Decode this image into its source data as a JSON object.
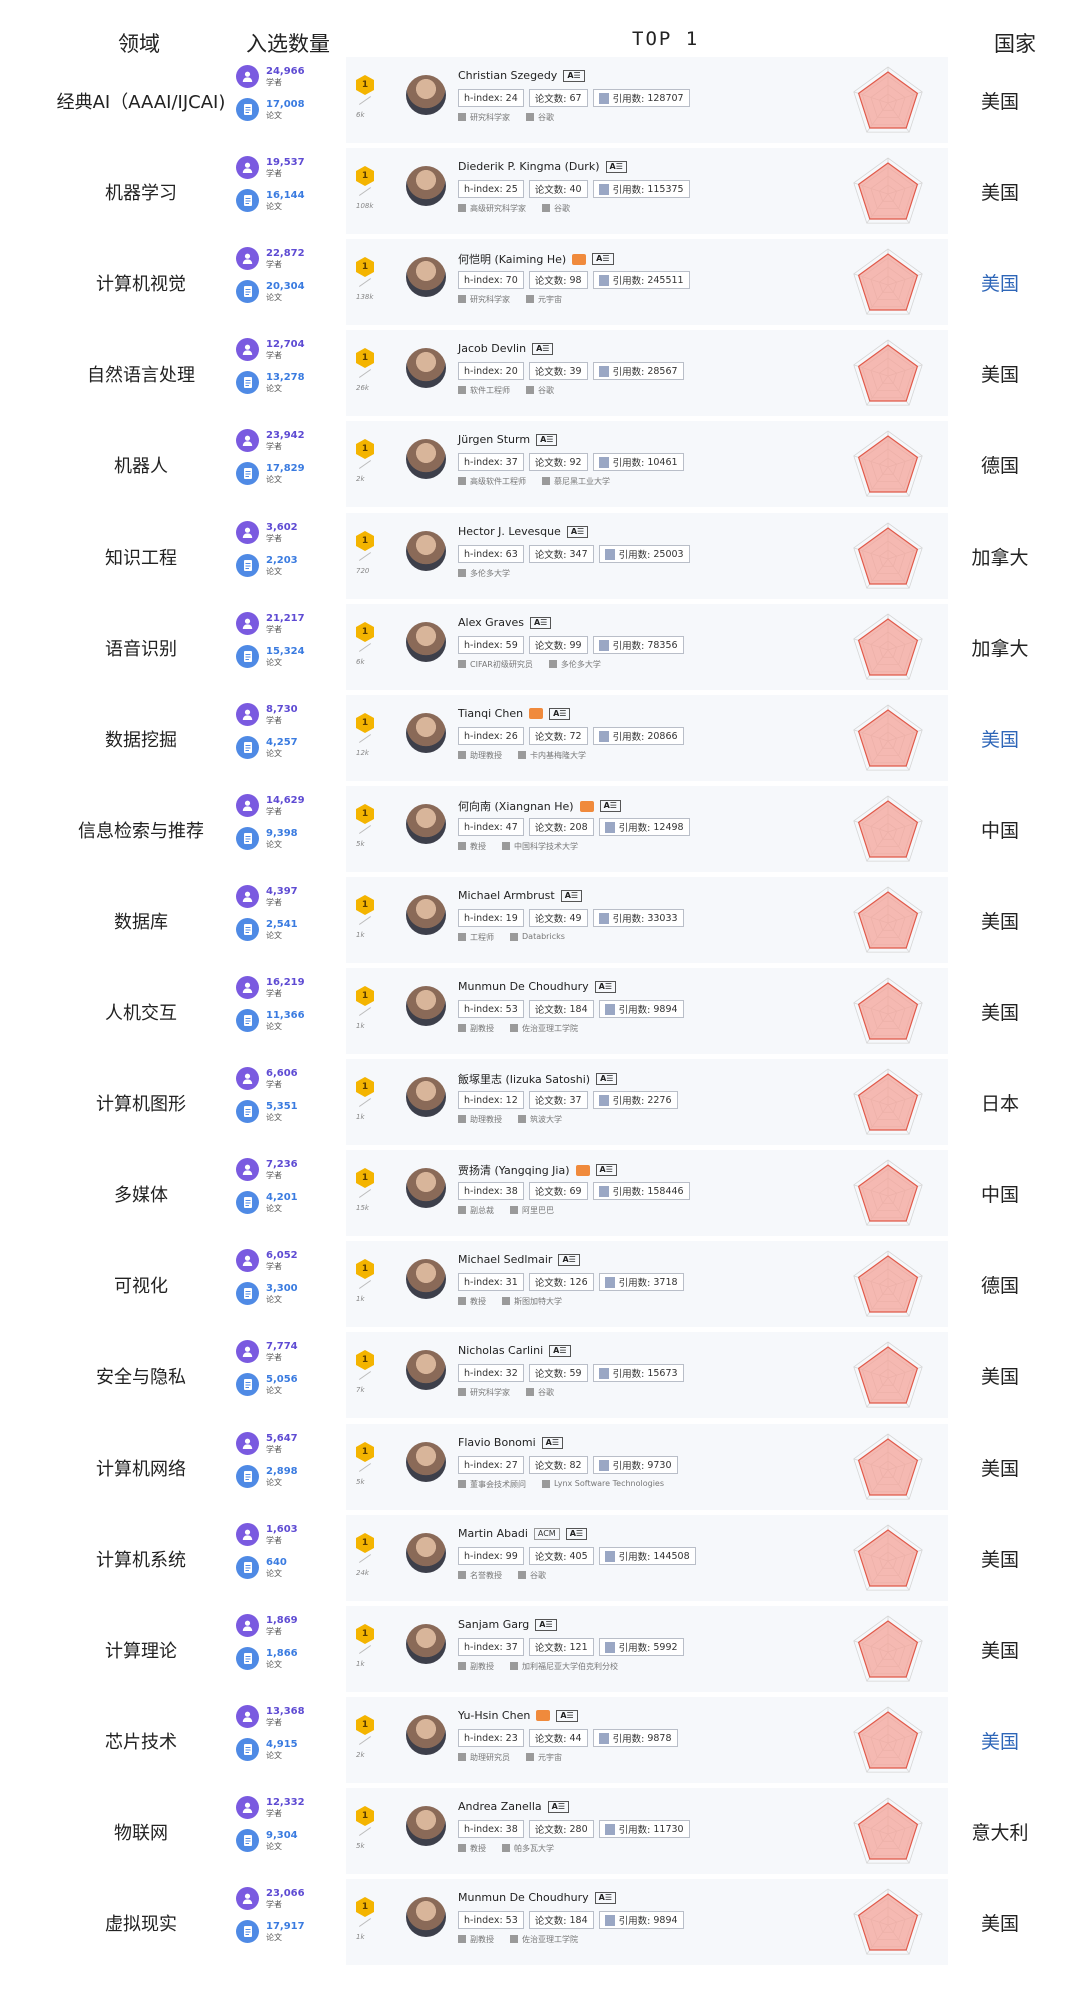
{
  "header": {
    "domain": "领域",
    "count": "入选数量",
    "top": "TOP 1",
    "country": "国家"
  },
  "labels": {
    "scholar": "学者",
    "paper": "论文",
    "hindex": "h-index:",
    "papers": "论文数:",
    "citations": "引用数:",
    "ai_badge": "A☰",
    "acm_badge": "ACM"
  },
  "colors": {
    "scholar_icon": "#7a5ae0",
    "paper_icon": "#4f8ae5",
    "medal": "#f4b400",
    "radar_fill": "#f4a49a",
    "radar_stroke": "#e05a4a",
    "country_blue": "#2e66b8"
  },
  "rows": [
    {
      "domain": "经典AI（AAAI/IJCAI)",
      "scholars": "24,966",
      "papers": "17,008",
      "medal_note": "6k",
      "name": "Christian Szegedy",
      "orange": false,
      "acm": false,
      "hindex": "24",
      "papercount": "67",
      "cites": "128707",
      "title": "研究科学家",
      "org": "谷歌",
      "country": "美国",
      "country_blue": false
    },
    {
      "domain": "机器学习",
      "scholars": "19,537",
      "papers": "16,144",
      "medal_note": "108k",
      "name": "Diederik P. Kingma (Durk)",
      "orange": false,
      "acm": false,
      "hindex": "25",
      "papercount": "40",
      "cites": "115375",
      "title": "高级研究科学家",
      "org": "谷歌",
      "country": "美国",
      "country_blue": false
    },
    {
      "domain": "计算机视觉",
      "scholars": "22,872",
      "papers": "20,304",
      "medal_note": "138k",
      "name": "何恺明 (Kaiming He)",
      "orange": true,
      "acm": false,
      "hindex": "70",
      "papercount": "98",
      "cites": "245511",
      "title": "研究科学家",
      "org": "元宇宙",
      "country": "美国",
      "country_blue": true
    },
    {
      "domain": "自然语言处理",
      "scholars": "12,704",
      "papers": "13,278",
      "medal_note": "26k",
      "name": "Jacob Devlin",
      "orange": false,
      "acm": false,
      "hindex": "20",
      "papercount": "39",
      "cites": "28567",
      "title": "软件工程师",
      "org": "谷歌",
      "country": "美国",
      "country_blue": false
    },
    {
      "domain": "机器人",
      "scholars": "23,942",
      "papers": "17,829",
      "medal_note": "2k",
      "name": "Jürgen Sturm",
      "orange": false,
      "acm": false,
      "hindex": "37",
      "papercount": "92",
      "cites": "10461",
      "title": "高级软件工程师",
      "org": "慕尼黑工业大学",
      "country": "德国",
      "country_blue": false
    },
    {
      "domain": "知识工程",
      "scholars": "3,602",
      "papers": "2,203",
      "medal_note": "720",
      "name": "Hector J. Levesque",
      "orange": false,
      "acm": false,
      "hindex": "63",
      "papercount": "347",
      "cites": "25003",
      "title": "多伦多大学",
      "org": "",
      "country": "加拿大",
      "country_blue": false
    },
    {
      "domain": "语音识别",
      "scholars": "21,217",
      "papers": "15,324",
      "medal_note": "6k",
      "name": "Alex Graves",
      "orange": false,
      "acm": false,
      "hindex": "59",
      "papercount": "99",
      "cites": "78356",
      "title": "CIFAR初级研究员",
      "org": "多伦多大学",
      "country": "加拿大",
      "country_blue": false
    },
    {
      "domain": "数据挖掘",
      "scholars": "8,730",
      "papers": "4,257",
      "medal_note": "12k",
      "name": "Tianqi Chen",
      "orange": true,
      "acm": false,
      "hindex": "26",
      "papercount": "72",
      "cites": "20866",
      "title": "助理教授",
      "org": "卡内基梅隆大学",
      "country": "美国",
      "country_blue": true
    },
    {
      "domain": "信息检索与推荐",
      "scholars": "14,629",
      "papers": "9,398",
      "medal_note": "5k",
      "name": "何向南 (Xiangnan He)",
      "orange": true,
      "acm": false,
      "hindex": "47",
      "papercount": "208",
      "cites": "12498",
      "title": "教授",
      "org": "中国科学技术大学",
      "country": "中国",
      "country_blue": false
    },
    {
      "domain": "数据库",
      "scholars": "4,397",
      "papers": "2,541",
      "medal_note": "1k",
      "name": "Michael Armbrust",
      "orange": false,
      "acm": false,
      "hindex": "19",
      "papercount": "49",
      "cites": "33033",
      "title": "工程师",
      "org": "Databricks",
      "country": "美国",
      "country_blue": false
    },
    {
      "domain": "人机交互",
      "scholars": "16,219",
      "papers": "11,366",
      "medal_note": "1k",
      "name": "Munmun De Choudhury",
      "orange": false,
      "acm": false,
      "hindex": "53",
      "papercount": "184",
      "cites": "9894",
      "title": "副教授",
      "org": "佐治亚理工学院",
      "country": "美国",
      "country_blue": false
    },
    {
      "domain": "计算机图形",
      "scholars": "6,606",
      "papers": "5,351",
      "medal_note": "1k",
      "name": "飯塚里志 (Iizuka Satoshi)",
      "orange": false,
      "acm": false,
      "hindex": "12",
      "papercount": "37",
      "cites": "2276",
      "title": "助理教授",
      "org": "筑波大学",
      "country": "日本",
      "country_blue": false
    },
    {
      "domain": "多媒体",
      "scholars": "7,236",
      "papers": "4,201",
      "medal_note": "15k",
      "name": "贾扬清 (Yangqing Jia)",
      "orange": true,
      "acm": false,
      "hindex": "38",
      "papercount": "69",
      "cites": "158446",
      "title": "副总裁",
      "org": "阿里巴巴",
      "country": "中国",
      "country_blue": false
    },
    {
      "domain": "可视化",
      "scholars": "6,052",
      "papers": "3,300",
      "medal_note": "1k",
      "name": "Michael Sedlmair",
      "orange": false,
      "acm": false,
      "hindex": "31",
      "papercount": "126",
      "cites": "3718",
      "title": "教授",
      "org": "斯图加特大学",
      "country": "德国",
      "country_blue": false
    },
    {
      "domain": "安全与隐私",
      "scholars": "7,774",
      "papers": "5,056",
      "medal_note": "7k",
      "name": "Nicholas Carlini",
      "orange": false,
      "acm": false,
      "hindex": "32",
      "papercount": "59",
      "cites": "15673",
      "title": "研究科学家",
      "org": "谷歌",
      "country": "美国",
      "country_blue": false
    },
    {
      "domain": "计算机网络",
      "scholars": "5,647",
      "papers": "2,898",
      "medal_note": "5k",
      "name": "Flavio Bonomi",
      "orange": false,
      "acm": false,
      "hindex": "27",
      "papercount": "82",
      "cites": "9730",
      "title": "董事会技术顾问",
      "org": "Lynx Software Technologies",
      "country": "美国",
      "country_blue": false
    },
    {
      "domain": "计算机系统",
      "scholars": "1,603",
      "papers": "640",
      "medal_note": "24k",
      "name": "Martin Abadi",
      "orange": false,
      "acm": true,
      "hindex": "99",
      "papercount": "405",
      "cites": "144508",
      "title": "名誉教授",
      "org": "谷歌",
      "country": "美国",
      "country_blue": false
    },
    {
      "domain": "计算理论",
      "scholars": "1,869",
      "papers": "1,866",
      "medal_note": "1k",
      "name": "Sanjam Garg",
      "orange": false,
      "acm": false,
      "hindex": "37",
      "papercount": "121",
      "cites": "5992",
      "title": "副教授",
      "org": "加利福尼亚大学伯克利分校",
      "country": "美国",
      "country_blue": false
    },
    {
      "domain": "芯片技术",
      "scholars": "13,368",
      "papers": "4,915",
      "medal_note": "2k",
      "name": "Yu-Hsin Chen",
      "orange": true,
      "acm": false,
      "hindex": "23",
      "papercount": "44",
      "cites": "9878",
      "title": "助理研究员",
      "org": "元宇宙",
      "country": "美国",
      "country_blue": true
    },
    {
      "domain": "物联网",
      "scholars": "12,332",
      "papers": "9,304",
      "medal_note": "5k",
      "name": "Andrea Zanella",
      "orange": false,
      "acm": false,
      "hindex": "38",
      "papercount": "280",
      "cites": "11730",
      "title": "教授",
      "org": "帕多瓦大学",
      "country": "意大利",
      "country_blue": false
    },
    {
      "domain": "虚拟现实",
      "scholars": "23,066",
      "papers": "17,917",
      "medal_note": "1k",
      "name": "Munmun De Choudhury",
      "orange": false,
      "acm": false,
      "hindex": "53",
      "papercount": "184",
      "cites": "9894",
      "title": "副教授",
      "org": "佐治亚理工学院",
      "country": "美国",
      "country_blue": false
    }
  ]
}
